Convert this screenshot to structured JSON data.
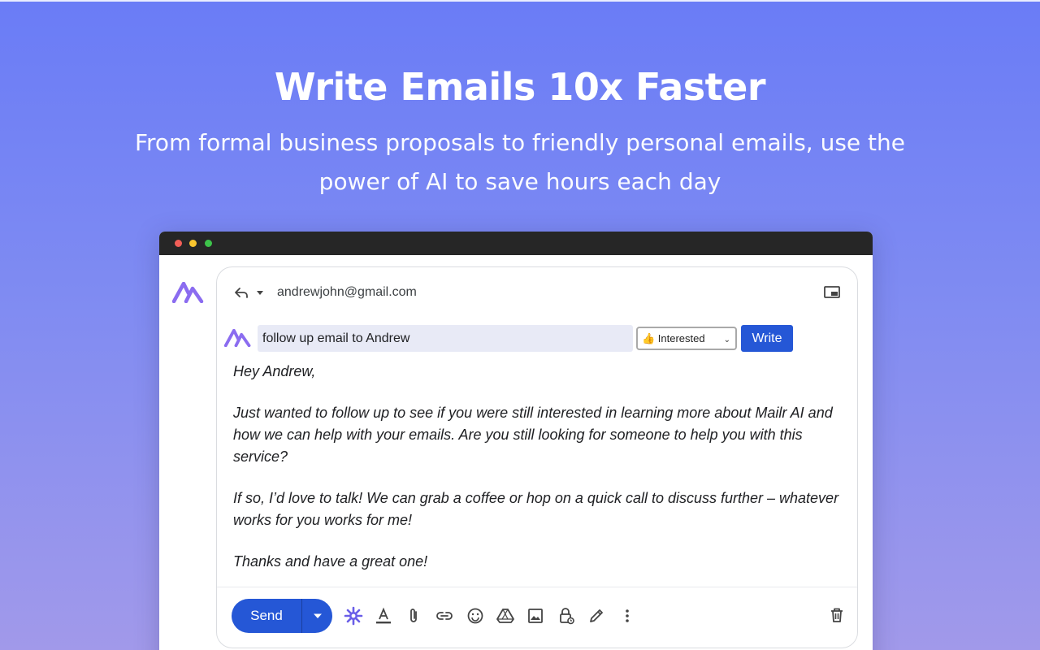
{
  "hero": {
    "title": "Write Emails 10x Faster",
    "subtitle_line1": "From formal business proposals to friendly personal emails, use the",
    "subtitle_line2": "power of AI to save hours each day"
  },
  "compose": {
    "recipient": "andrewjohn@gmail.com",
    "prompt_value": "follow up email to Andrew",
    "tone_selected": "👍 Interested",
    "write_label": "Write",
    "body": {
      "greeting": "Hey Andrew,",
      "paragraph1": "Just wanted to follow up to see if you were still interested in learning more about Mailr AI and how we can help with your emails. Are you still looking for someone to help you with this service?",
      "paragraph2": "If so, I’d love to talk! We can grab a coffee or hop on a quick call to discuss further – whatever works for you works for me!",
      "closing": "Thanks and have a great one!"
    },
    "send_label": "Send"
  },
  "toolbar_icons": [
    "ai-sparkle-icon",
    "text-format-icon",
    "attachment-icon",
    "link-icon",
    "emoji-icon",
    "drive-icon",
    "image-icon",
    "confidential-mode-icon",
    "signature-icon",
    "more-options-icon",
    "trash-icon"
  ],
  "colors": {
    "brand_purple": "#8b6cf0",
    "primary_blue": "#2557d6",
    "prompt_bg": "#e8eaf6",
    "titlebar": "#262626"
  }
}
